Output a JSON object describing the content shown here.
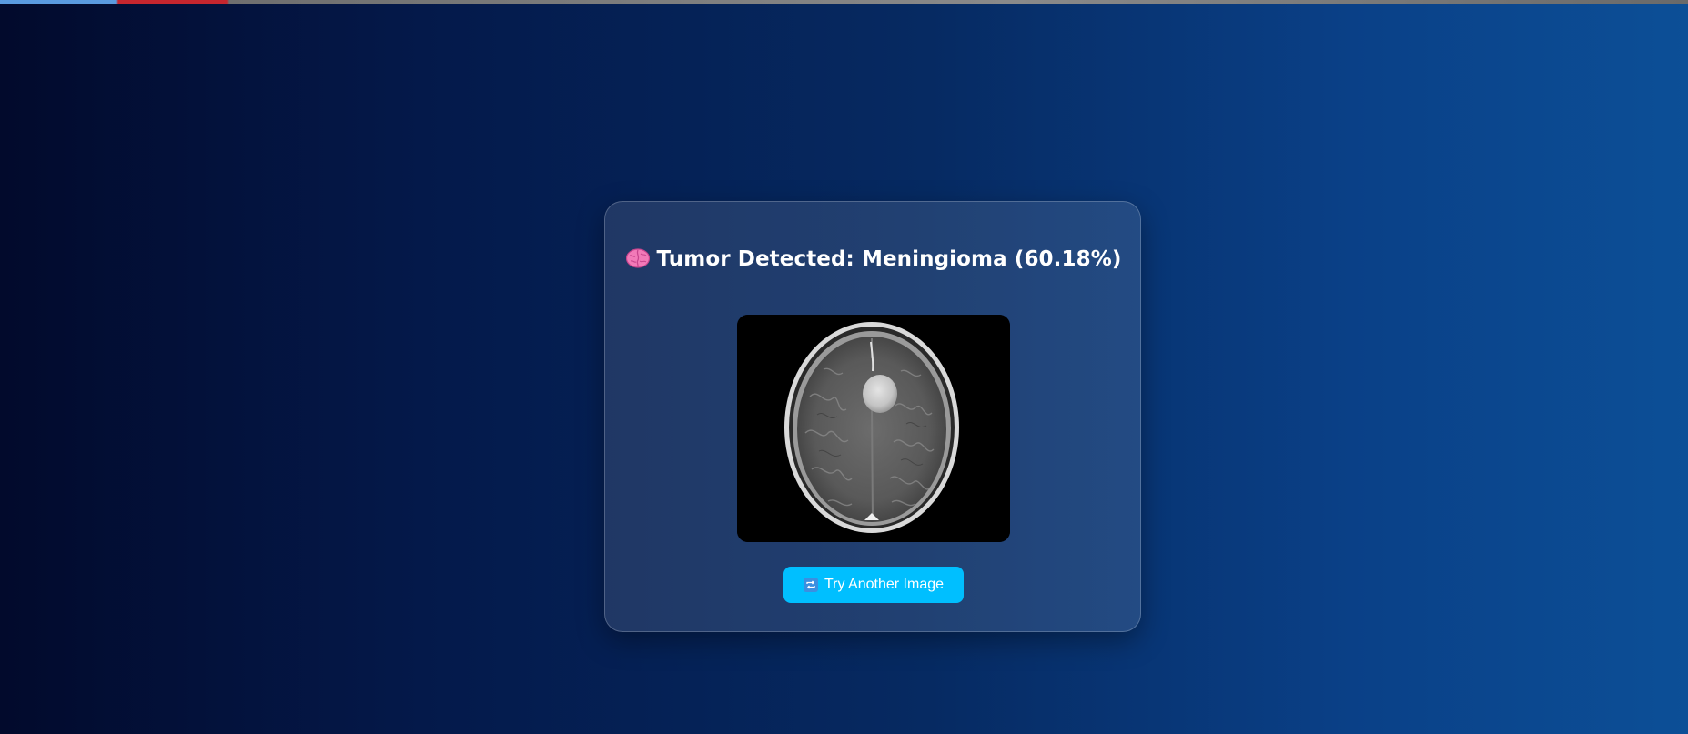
{
  "browser": {
    "tab_accent_color": "#c6262e"
  },
  "result": {
    "icon": "brain-icon",
    "title": "Tumor Detected: Meningioma (60.18%)",
    "prediction": "Meningioma",
    "confidence_percent": 60.18
  },
  "scan_image": {
    "subject": "mri-brain-scan"
  },
  "retry_button": {
    "icon": "repeat-icon",
    "label": "Try Another Image"
  },
  "theme": {
    "background_start": "#020a2c",
    "background_end": "#0c4f97",
    "button_color": "#00bfff",
    "text_color": "#ffffff"
  }
}
